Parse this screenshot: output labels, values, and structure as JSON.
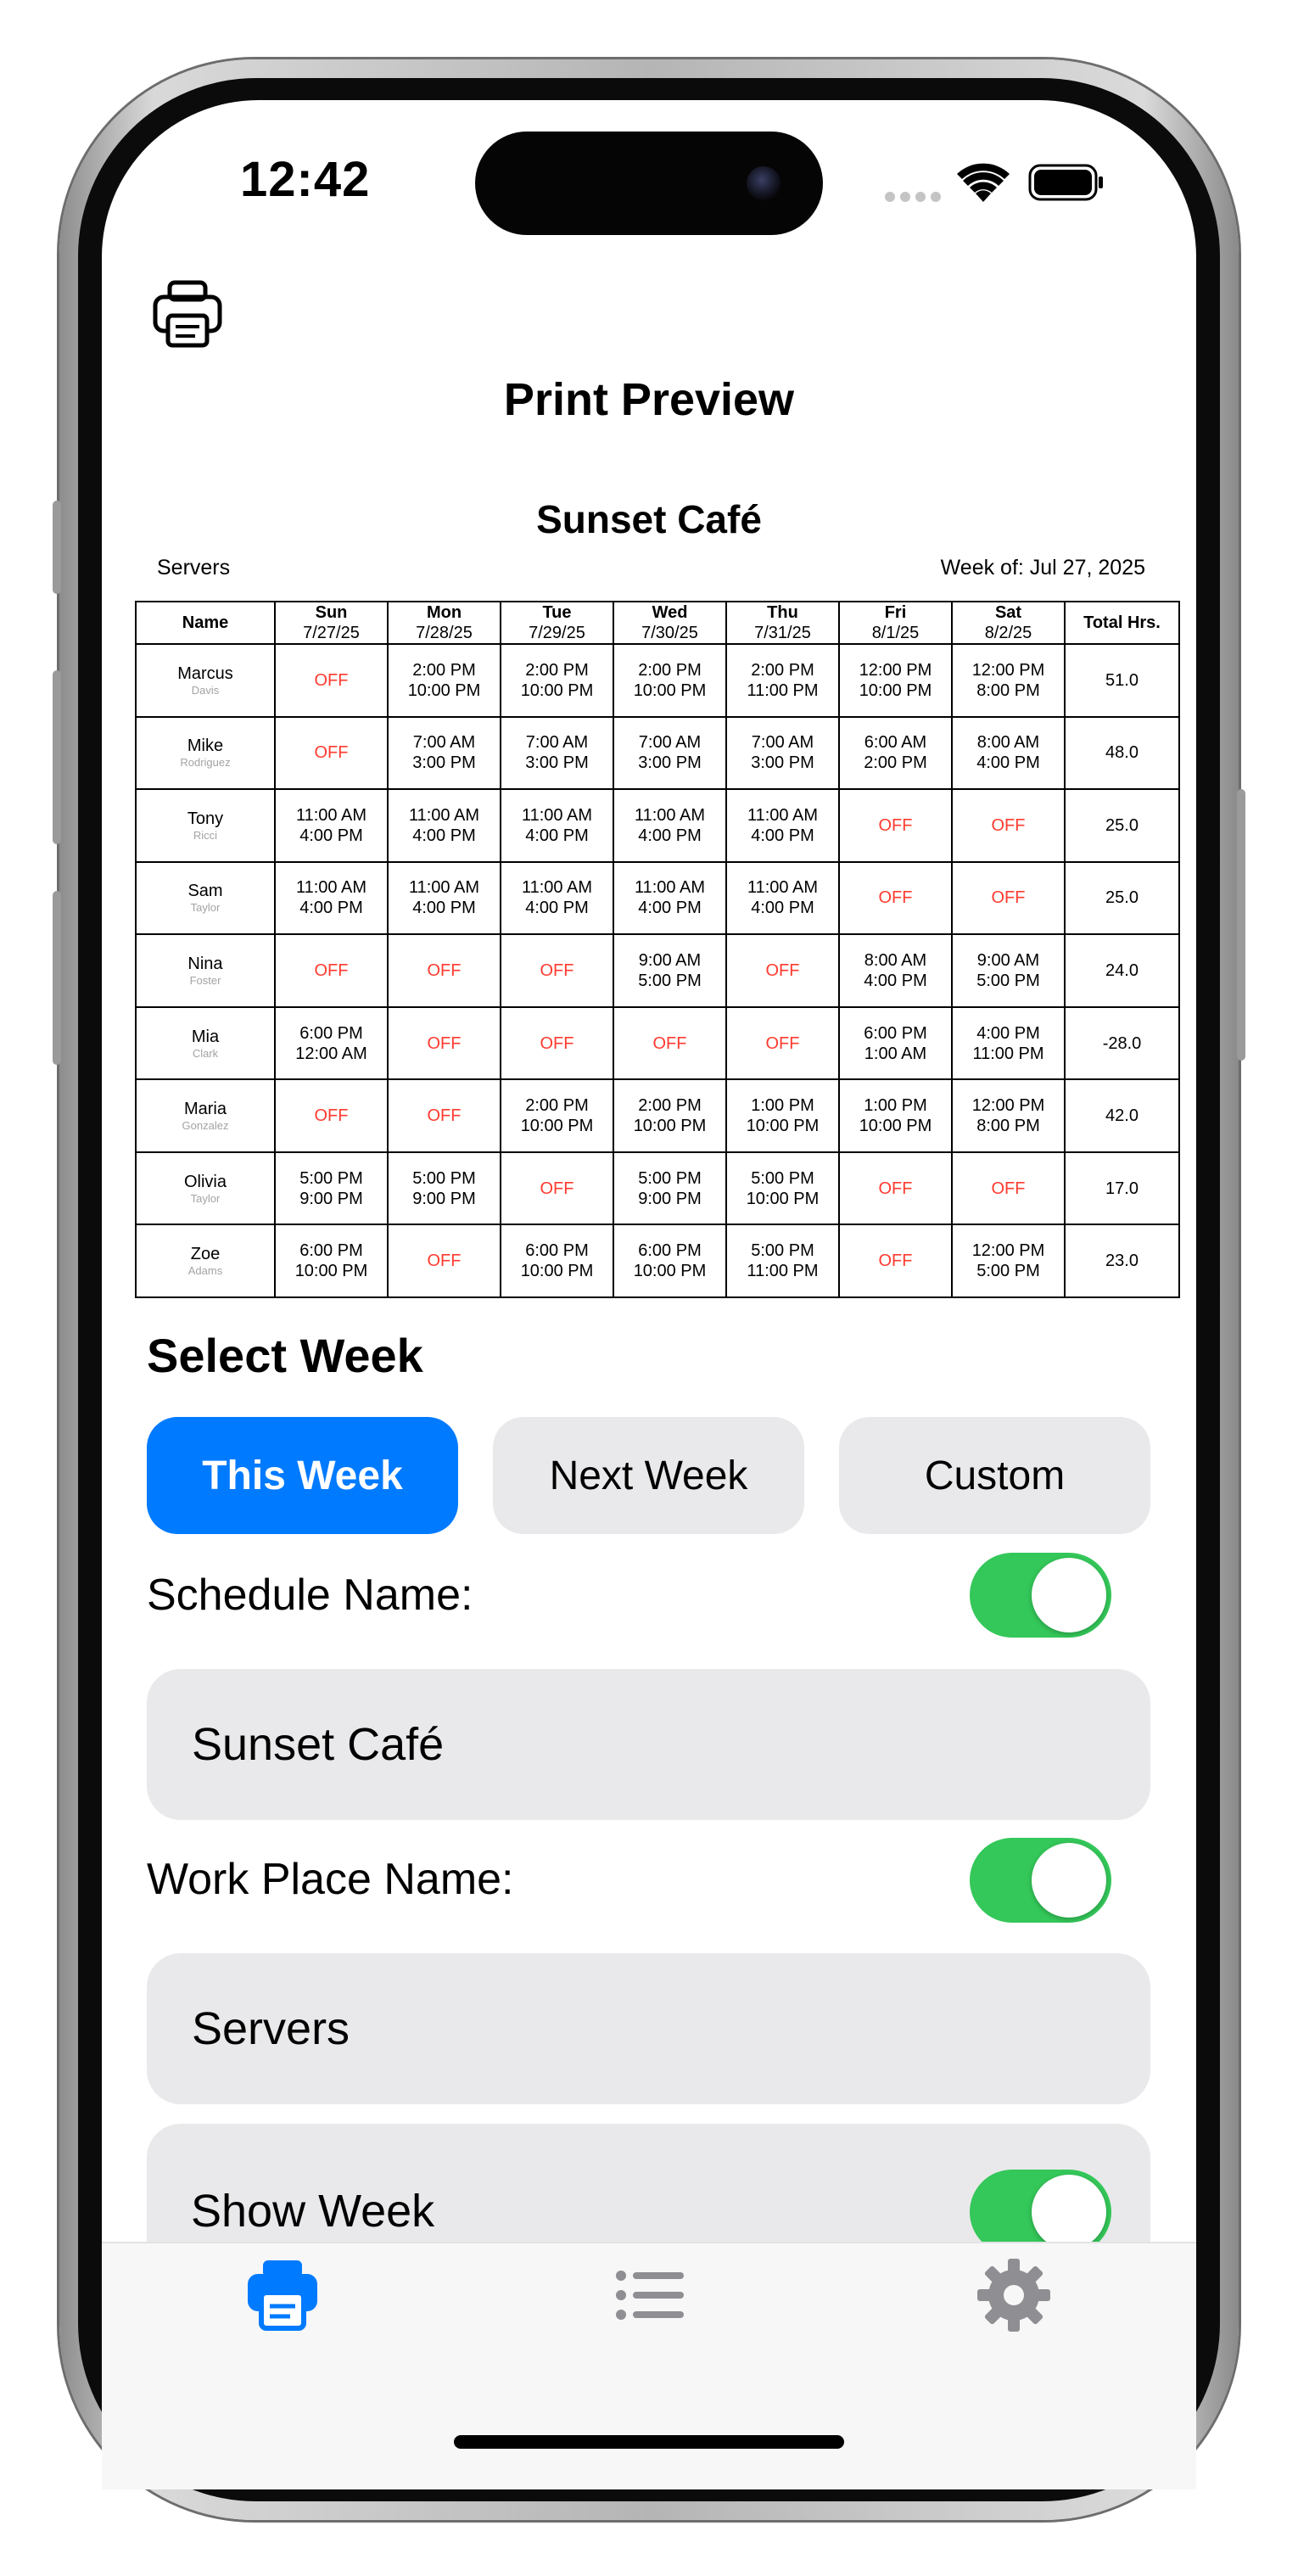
{
  "status_bar": {
    "time": "12:42"
  },
  "header": {
    "title": "Print Preview",
    "print_icon": "printer-icon"
  },
  "schedule": {
    "title": "Sunset Café",
    "workplace": "Servers",
    "week_of": "Week of: Jul 27, 2025",
    "columns": [
      {
        "label": "Name"
      },
      {
        "label": "Sun",
        "date": "7/27/25"
      },
      {
        "label": "Mon",
        "date": "7/28/25"
      },
      {
        "label": "Tue",
        "date": "7/29/25"
      },
      {
        "label": "Wed",
        "date": "7/30/25"
      },
      {
        "label": "Thu",
        "date": "7/31/25"
      },
      {
        "label": "Fri",
        "date": "8/1/25"
      },
      {
        "label": "Sat",
        "date": "8/2/25"
      },
      {
        "label": "Total Hrs."
      }
    ],
    "rows": [
      {
        "first": "Marcus",
        "last": "Davis",
        "shifts": [
          [
            "OFF"
          ],
          [
            "2:00 PM",
            "10:00 PM"
          ],
          [
            "2:00 PM",
            "10:00 PM"
          ],
          [
            "2:00 PM",
            "10:00 PM"
          ],
          [
            "2:00 PM",
            "11:00 PM"
          ],
          [
            "12:00 PM",
            "10:00 PM"
          ],
          [
            "12:00 PM",
            "8:00 PM"
          ]
        ],
        "total": "51.0"
      },
      {
        "first": "Mike",
        "last": "Rodriguez",
        "shifts": [
          [
            "OFF"
          ],
          [
            "7:00 AM",
            "3:00 PM"
          ],
          [
            "7:00 AM",
            "3:00 PM"
          ],
          [
            "7:00 AM",
            "3:00 PM"
          ],
          [
            "7:00 AM",
            "3:00 PM"
          ],
          [
            "6:00 AM",
            "2:00 PM"
          ],
          [
            "8:00 AM",
            "4:00 PM"
          ]
        ],
        "total": "48.0"
      },
      {
        "first": "Tony",
        "last": "Ricci",
        "shifts": [
          [
            "11:00 AM",
            "4:00 PM"
          ],
          [
            "11:00 AM",
            "4:00 PM"
          ],
          [
            "11:00 AM",
            "4:00 PM"
          ],
          [
            "11:00 AM",
            "4:00 PM"
          ],
          [
            "11:00 AM",
            "4:00 PM"
          ],
          [
            "OFF"
          ],
          [
            "OFF"
          ]
        ],
        "total": "25.0"
      },
      {
        "first": "Sam",
        "last": "Taylor",
        "shifts": [
          [
            "11:00 AM",
            "4:00 PM"
          ],
          [
            "11:00 AM",
            "4:00 PM"
          ],
          [
            "11:00 AM",
            "4:00 PM"
          ],
          [
            "11:00 AM",
            "4:00 PM"
          ],
          [
            "11:00 AM",
            "4:00 PM"
          ],
          [
            "OFF"
          ],
          [
            "OFF"
          ]
        ],
        "total": "25.0"
      },
      {
        "first": "Nina",
        "last": "Foster",
        "shifts": [
          [
            "OFF"
          ],
          [
            "OFF"
          ],
          [
            "OFF"
          ],
          [
            "9:00 AM",
            "5:00 PM"
          ],
          [
            "OFF"
          ],
          [
            "8:00 AM",
            "4:00 PM"
          ],
          [
            "9:00 AM",
            "5:00 PM"
          ]
        ],
        "total": "24.0"
      },
      {
        "first": "Mia",
        "last": "Clark",
        "shifts": [
          [
            "6:00 PM",
            "12:00 AM"
          ],
          [
            "OFF"
          ],
          [
            "OFF"
          ],
          [
            "OFF"
          ],
          [
            "OFF"
          ],
          [
            "6:00 PM",
            "1:00 AM"
          ],
          [
            "4:00 PM",
            "11:00 PM"
          ]
        ],
        "total": "-28.0"
      },
      {
        "first": "Maria",
        "last": "Gonzalez",
        "shifts": [
          [
            "OFF"
          ],
          [
            "OFF"
          ],
          [
            "2:00 PM",
            "10:00 PM"
          ],
          [
            "2:00 PM",
            "10:00 PM"
          ],
          [
            "1:00 PM",
            "10:00 PM"
          ],
          [
            "1:00 PM",
            "10:00 PM"
          ],
          [
            "12:00 PM",
            "8:00 PM"
          ]
        ],
        "total": "42.0"
      },
      {
        "first": "Olivia",
        "last": "Taylor",
        "shifts": [
          [
            "5:00 PM",
            "9:00 PM"
          ],
          [
            "5:00 PM",
            "9:00 PM"
          ],
          [
            "OFF"
          ],
          [
            "5:00 PM",
            "9:00 PM"
          ],
          [
            "5:00 PM",
            "10:00 PM"
          ],
          [
            "OFF"
          ],
          [
            "OFF"
          ]
        ],
        "total": "17.0"
      },
      {
        "first": "Zoe",
        "last": "Adams",
        "shifts": [
          [
            "6:00 PM",
            "10:00 PM"
          ],
          [
            "OFF"
          ],
          [
            "6:00 PM",
            "10:00 PM"
          ],
          [
            "6:00 PM",
            "10:00 PM"
          ],
          [
            "5:00 PM",
            "11:00 PM"
          ],
          [
            "OFF"
          ],
          [
            "12:00 PM",
            "5:00 PM"
          ]
        ],
        "total": "23.0"
      }
    ]
  },
  "select_week": {
    "title": "Select Week",
    "options": [
      {
        "label": "This Week",
        "selected": true
      },
      {
        "label": "Next Week",
        "selected": false
      },
      {
        "label": "Custom",
        "selected": false
      }
    ]
  },
  "schedule_name": {
    "label": "Schedule Name:",
    "toggle_on": true,
    "value": "Sunset Café"
  },
  "work_place_name": {
    "label": "Work Place Name:",
    "toggle_on": true,
    "value": "Servers"
  },
  "show_week": {
    "label": "Show Week",
    "toggle_on": true
  },
  "tabbar": {
    "tabs": [
      {
        "icon": "printer-icon",
        "selected": true
      },
      {
        "icon": "list-icon",
        "selected": false
      },
      {
        "icon": "gear-icon",
        "selected": false
      }
    ]
  },
  "colors": {
    "accent": "#007aff",
    "toggle_on": "#34c759",
    "off_text": "#ff3b30",
    "field_bg": "#e9e9eb"
  }
}
